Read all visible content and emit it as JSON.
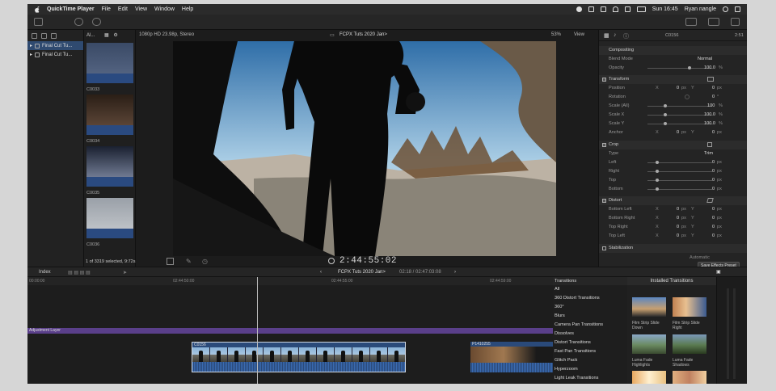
{
  "menubar": {
    "app": "QuickTime Player",
    "items": [
      "File",
      "Edit",
      "View",
      "Window",
      "Help"
    ],
    "clock": "Sun 16:45",
    "user": "Ryan nangle"
  },
  "library": {
    "header": "Al...",
    "items": [
      "Final Cut Tu...",
      "Final Cut Tu..."
    ]
  },
  "browser": {
    "clips": [
      "C0033",
      "C0034",
      "C0035",
      "C0036"
    ],
    "footer": "1 of 3319 selected, 9:72s"
  },
  "viewer": {
    "format": "1080p HD 23.98p, Stereo",
    "project": "FCPX Tuts 2020 Jan>",
    "zoom": "53%",
    "view_menu": "View",
    "timecode": "2:44:55:02"
  },
  "inspector": {
    "clip_name": "C0156",
    "duration": "2:51",
    "compositing": "Compositing",
    "blend_mode_label": "Blend Mode",
    "blend_mode_value": "Normal",
    "opacity_label": "Opacity",
    "opacity_value": "100.0",
    "transform": "Transform",
    "position_label": "Position",
    "rotation_label": "Rotation",
    "scale_all_label": "Scale (All)",
    "scale_x_label": "Scale X",
    "scale_y_label": "Scale Y",
    "anchor_label": "Anchor",
    "crop": "Crop",
    "type_label": "Type",
    "type_value": "Trim",
    "left_label": "Left",
    "right_label": "Right",
    "top_label": "Top",
    "bottom_label": "Bottom",
    "distort": "Distort",
    "bottom_left_label": "Bottom Left",
    "bottom_right_label": "Bottom Right",
    "top_right_label": "Top Right",
    "top_left_label": "Top Left",
    "stabilization": "Stabilization",
    "automatic": "Automatic",
    "save_preset": "Save Effects Preset",
    "x": "X",
    "y": "Y",
    "zero": "0",
    "px": "px",
    "pct": "%",
    "deg": "°",
    "hundred": "100",
    "hundred_dec": "100.0"
  },
  "timeline": {
    "index": "Index",
    "project": "FCPX Tuts 2020 Jan>",
    "duration": "02:18 / 02:47:03:08",
    "ruler": [
      "00:00:00",
      "02:44:50:00",
      "02:44:55:00",
      "02:44:59:00"
    ],
    "adjustment_layer": "Adjustment Layer",
    "clip_a": "C0156",
    "clip_b": "P1410255"
  },
  "transitions": {
    "title": "Transitions",
    "installed": "Installed Transitions",
    "categories": [
      "All",
      "360 Distort Transitions",
      "360°",
      "Blurs",
      "Camera Pan Transitions",
      "Dissolves",
      "Distort Transitions",
      "Fast Pan Transitions",
      "Glitch Pack",
      "Hyperzoom",
      "Light Leak Transitions"
    ],
    "thumbs": [
      "Film Strip Slide Down",
      "Film Strip Slide Right",
      "Luma Fade Highlights",
      "Luma Fade Shadows"
    ]
  }
}
